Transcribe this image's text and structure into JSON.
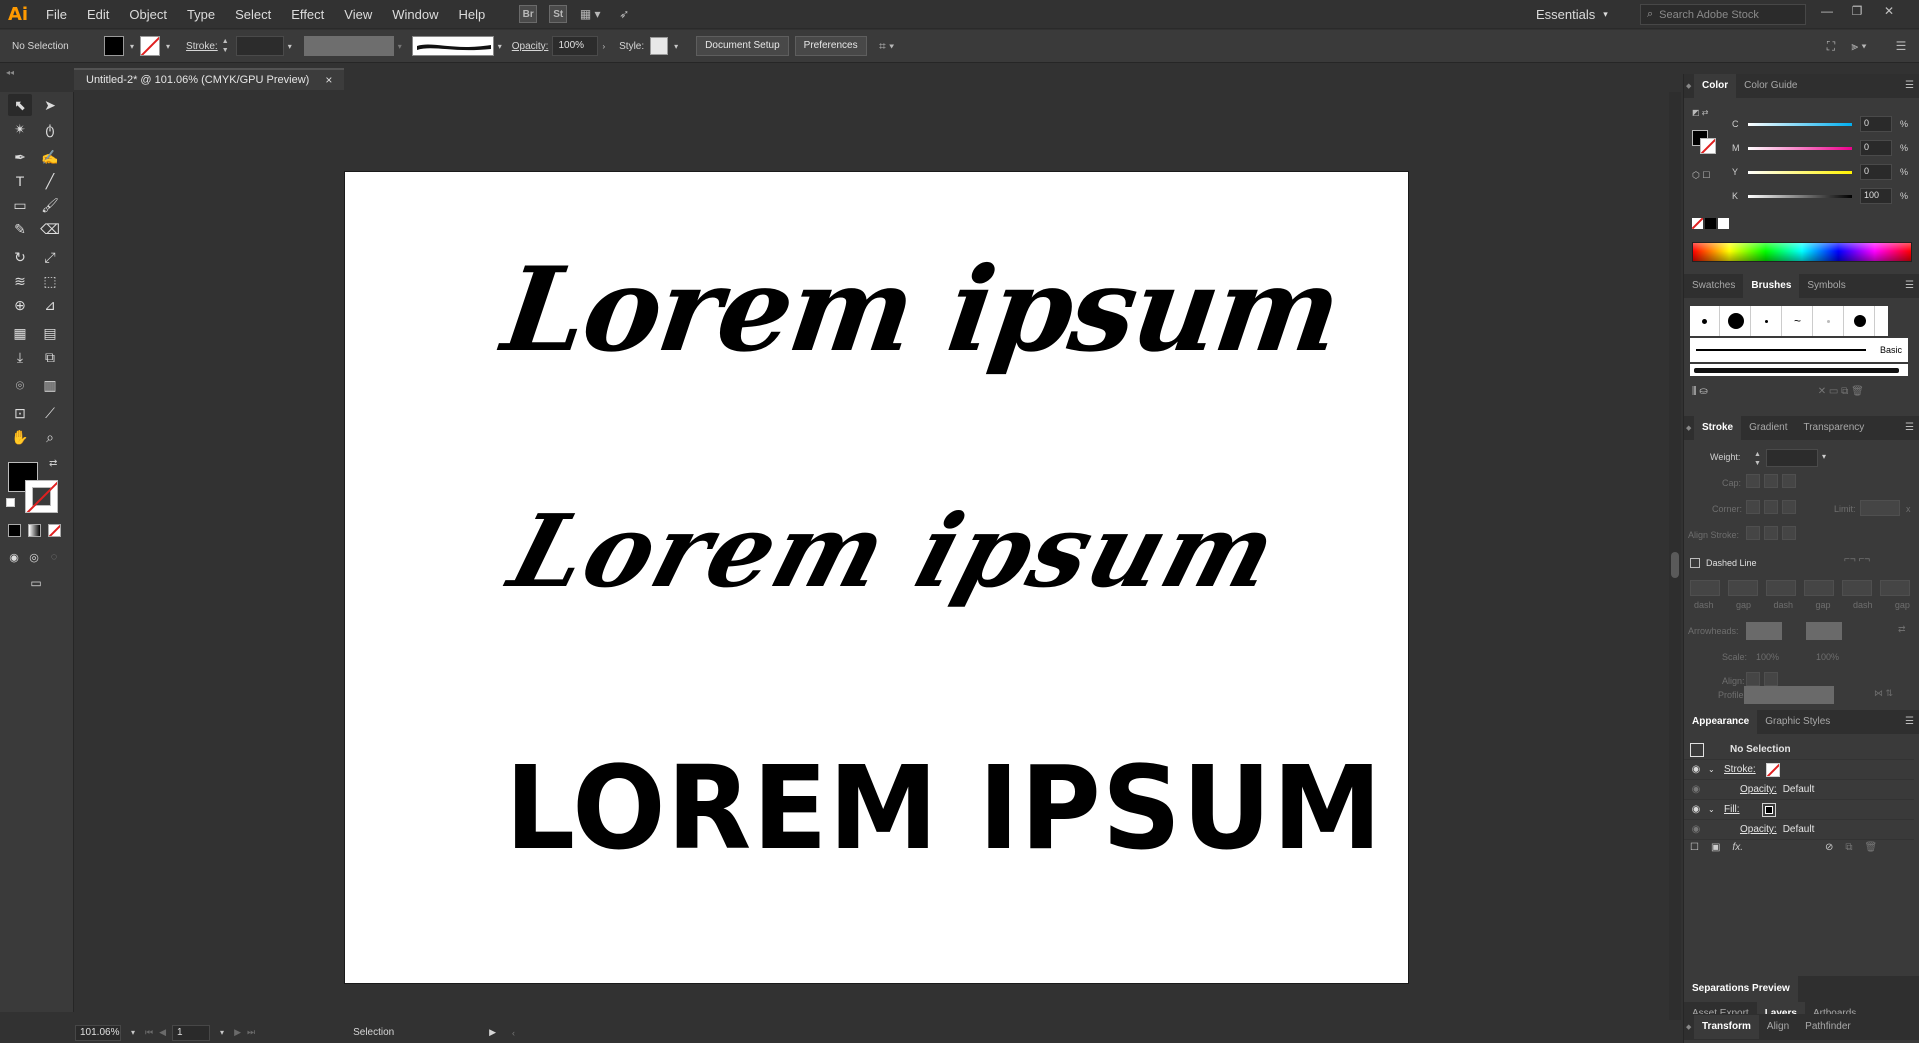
{
  "app": {
    "logo": "Ai",
    "menu": [
      "File",
      "Edit",
      "Object",
      "Type",
      "Select",
      "Effect",
      "View",
      "Window",
      "Help"
    ],
    "bridge_label": "Br",
    "stock_label": "St",
    "workspace": "Essentials",
    "search_placeholder": "Search Adobe Stock"
  },
  "control_bar": {
    "selection_status": "No Selection",
    "stroke_label": "Stroke:",
    "opacity_label": "Opacity:",
    "opacity_value": "100%",
    "style_label": "Style:",
    "document_setup": "Document Setup",
    "preferences": "Preferences"
  },
  "document": {
    "tab_title": "Untitled-2* @ 101.06% (CMYK/GPU Preview)",
    "close": "×",
    "artboard_text": [
      "Lorem ipsum",
      "Lorem ipsum",
      "LOREM IPSUM"
    ]
  },
  "status_bar": {
    "zoom": "101.06%",
    "artboard_number": "1",
    "tool_name": "Selection"
  },
  "color_panel": {
    "tabs": [
      "Color",
      "Color Guide"
    ],
    "channels": [
      {
        "label": "C",
        "value": "0",
        "color": "#00aeef"
      },
      {
        "label": "M",
        "value": "0",
        "color": "#ec008c"
      },
      {
        "label": "Y",
        "value": "0",
        "color": "#fff200"
      },
      {
        "label": "K",
        "value": "100",
        "color": "#000000"
      }
    ],
    "unit": "%"
  },
  "brushes_panel": {
    "tabs": [
      "Swatches",
      "Brushes",
      "Symbols"
    ],
    "basic_label": "Basic"
  },
  "stroke_panel": {
    "tabs": [
      "Stroke",
      "Gradient",
      "Transparency"
    ],
    "weight_label": "Weight:",
    "cap_label": "Cap:",
    "corner_label": "Corner:",
    "limit_label": "Limit:",
    "limit_suffix": "x",
    "align_stroke_label": "Align Stroke:",
    "dashed_line_label": "Dashed Line",
    "dash_labels": [
      "dash",
      "gap",
      "dash",
      "gap",
      "dash",
      "gap"
    ],
    "arrowheads_label": "Arrowheads:",
    "scale_label": "Scale:",
    "scale_values": [
      "100%",
      "100%"
    ],
    "align_label": "Align:",
    "profile_label": "Profile:"
  },
  "appearance_panel": {
    "tabs": [
      "Appearance",
      "Graphic Styles"
    ],
    "title": "No Selection",
    "stroke_label": "Stroke:",
    "fill_label": "Fill:",
    "opacity_label": "Opacity:",
    "opacity_value": "Default",
    "fx_label": "fx."
  },
  "bottom_panels": {
    "tabs1": [
      "Asset Export",
      "Layers",
      "Artboards"
    ],
    "separations": "Separations Preview",
    "tabs2": [
      "Transform",
      "Align",
      "Pathfinder"
    ]
  },
  "colors": {
    "accent_orange": "#ff9a00",
    "panel_bg": "#3a3a3a",
    "app_bg": "#323232"
  }
}
